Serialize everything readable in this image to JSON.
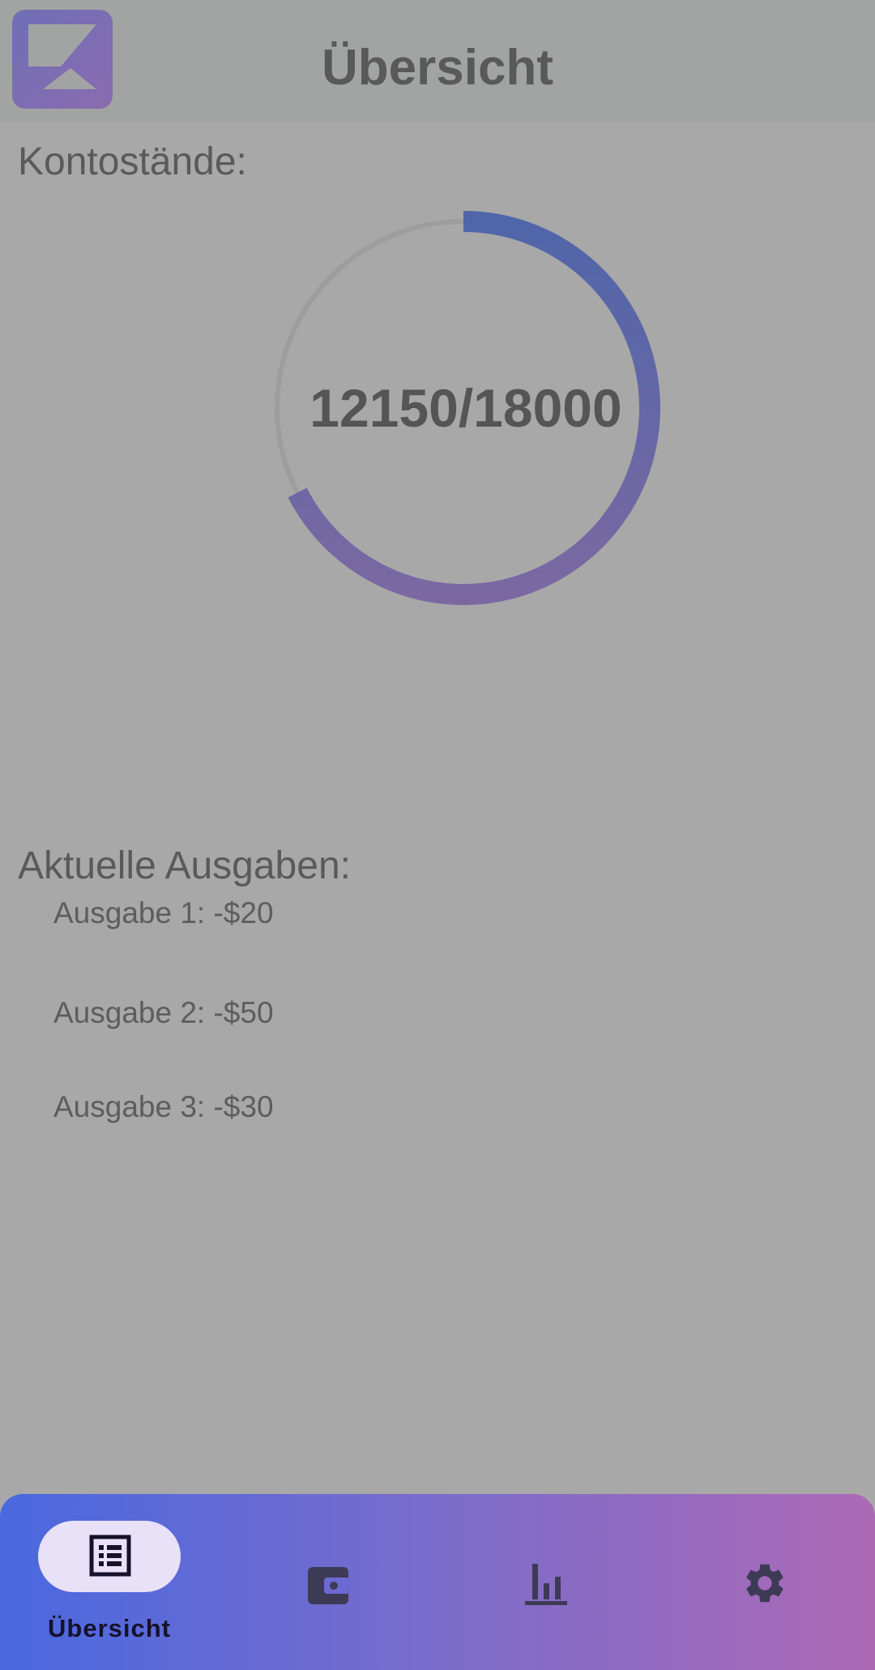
{
  "app": {
    "title": "Übersicht"
  },
  "balances": {
    "label": "Kontostände:",
    "display": "12150/18000",
    "current": 12150,
    "total": 18000,
    "fraction": 0.675
  },
  "expenses": {
    "label": "Aktuelle Ausgaben:",
    "items": [
      {
        "text": "Ausgabe 1: -$20"
      },
      {
        "text": "Ausgabe 2: -$50"
      },
      {
        "text": "Ausgabe 3: -$30"
      }
    ]
  },
  "nav": {
    "items": [
      {
        "icon": "list-icon",
        "label": "Übersicht",
        "selected": true
      },
      {
        "icon": "wallet-icon",
        "label": "",
        "selected": false
      },
      {
        "icon": "bar-chart-icon",
        "label": "",
        "selected": false
      },
      {
        "icon": "gear-icon",
        "label": "",
        "selected": false
      }
    ]
  },
  "colors": {
    "gradient_start": "#4a68df",
    "gradient_mid": "#7a6ccb",
    "gradient_end": "#ad69b6",
    "gauge_start": "#4f66a9",
    "gauge_end": "#7b68a2",
    "pill": "#e8e1f8"
  }
}
